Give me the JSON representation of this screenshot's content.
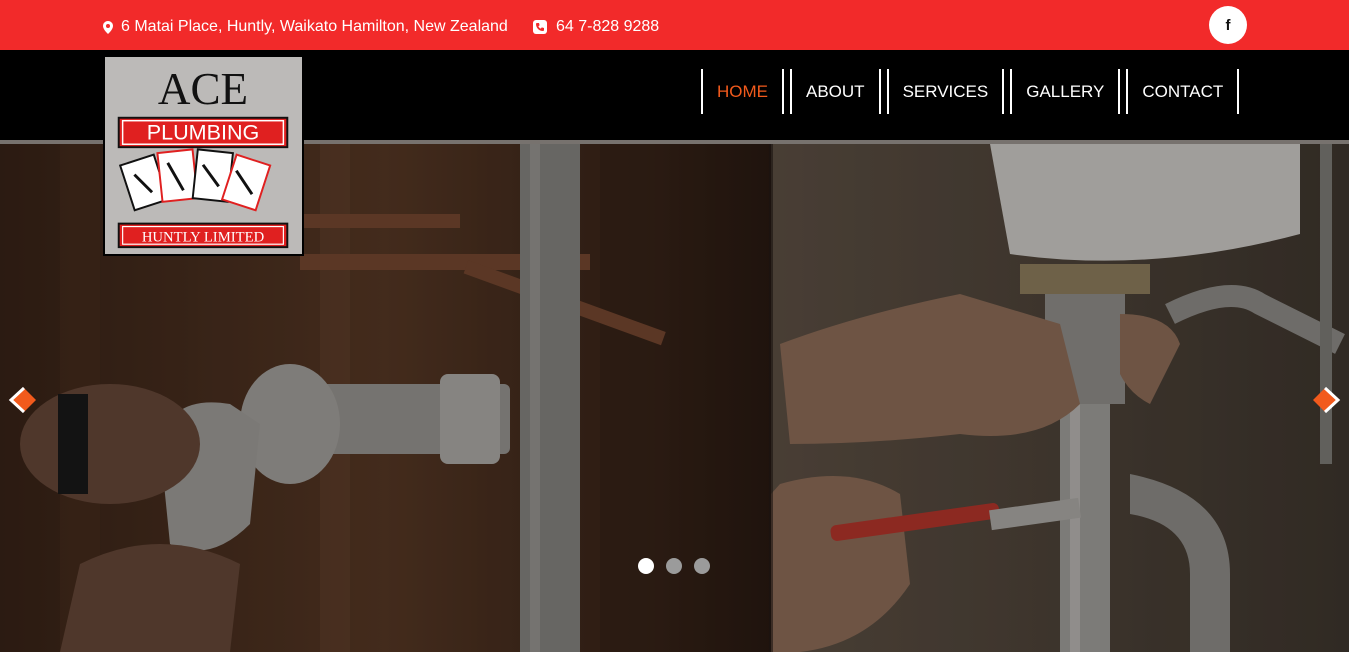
{
  "topbar": {
    "address": "6 Matai Place, Huntly, Waikato Hamilton, New Zealand",
    "phone": "64 7-828 9288",
    "social": "f",
    "social_icon": "facebook-icon",
    "bg_color": "#f22a2a"
  },
  "logo": {
    "line1": "ACE",
    "line2": "PLUMBING",
    "line3": "HUNTLY LIMITED"
  },
  "nav": {
    "items": [
      {
        "label": "HOME",
        "active": true
      },
      {
        "label": "ABOUT",
        "active": false
      },
      {
        "label": "SERVICES",
        "active": false
      },
      {
        "label": "GALLERY",
        "active": false
      },
      {
        "label": "CONTACT",
        "active": false
      }
    ],
    "active_color": "#f25a1c"
  },
  "slider": {
    "slides": 3,
    "active_slide": 1,
    "prev_icon": "arrow-left-icon",
    "next_icon": "arrow-right-icon"
  }
}
